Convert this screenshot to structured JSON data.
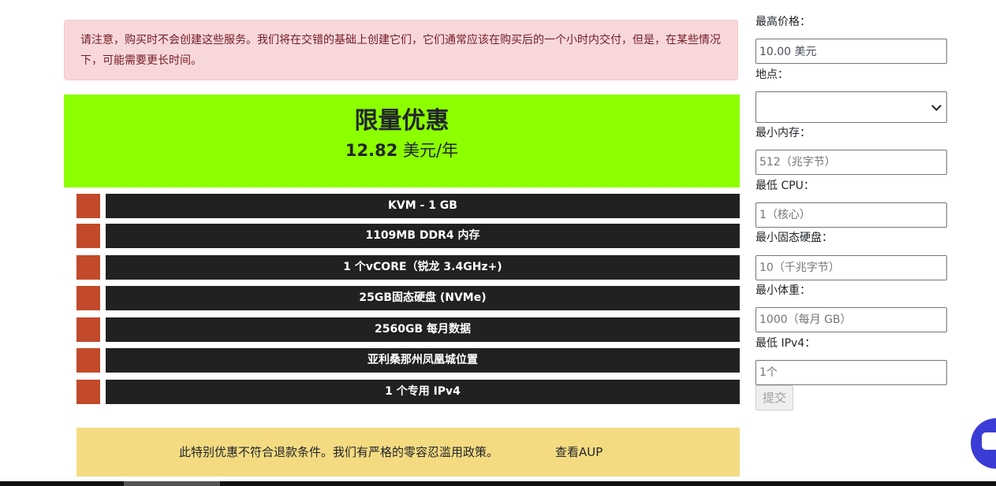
{
  "notice": {
    "text": "请注意，购买时不会创建这些服务。我们将在交错的基础上创建它们，它们通常应该在购买后的一个小时内交付，但是，在某些情况下，可能需要更长时间。"
  },
  "deal": {
    "title": "限量优惠",
    "price_amount": "12.82",
    "price_unit": "美元/年"
  },
  "specs": [
    "KVM - 1 GB",
    "1109MB DDR4 内存",
    "1 个vCORE（锐龙 3.4GHz+)",
    "25GB固态硬盘 (NVMe)",
    "2560GB 每月数据",
    "亚利桑那州凤凰城位置",
    "1 个专用 IPv4"
  ],
  "refund": {
    "text": "此特别优惠不符合退款条件。我们有严格的零容忍滥用政策。",
    "aup_link": "查看AUP"
  },
  "filters": {
    "max_price_label": "最高价格：",
    "max_price_value": "10.00 美元",
    "location_label": "地点：",
    "location_value": "",
    "min_ram_label": "最小内存：",
    "min_ram_placeholder": "512（兆字节）",
    "min_cpu_label": "最低 CPU：",
    "min_cpu_placeholder": "1（核心）",
    "min_ssd_label": "最小固态硬盘：",
    "min_ssd_placeholder": "10（千兆字节）",
    "min_bandwidth_label": "最小体重：",
    "min_bandwidth_placeholder": "1000（每月 GB）",
    "min_ipv4_label": "最低 IPv4：",
    "min_ipv4_placeholder": "1个",
    "submit_label": "提交"
  },
  "colors": {
    "banner": "#8cff00",
    "spec_bar": "#212121",
    "spec_marker": "#c24a2a",
    "refund_bg": "#f4db82",
    "alert_bg": "#f8d7da",
    "chat": "#3b3bd6"
  }
}
